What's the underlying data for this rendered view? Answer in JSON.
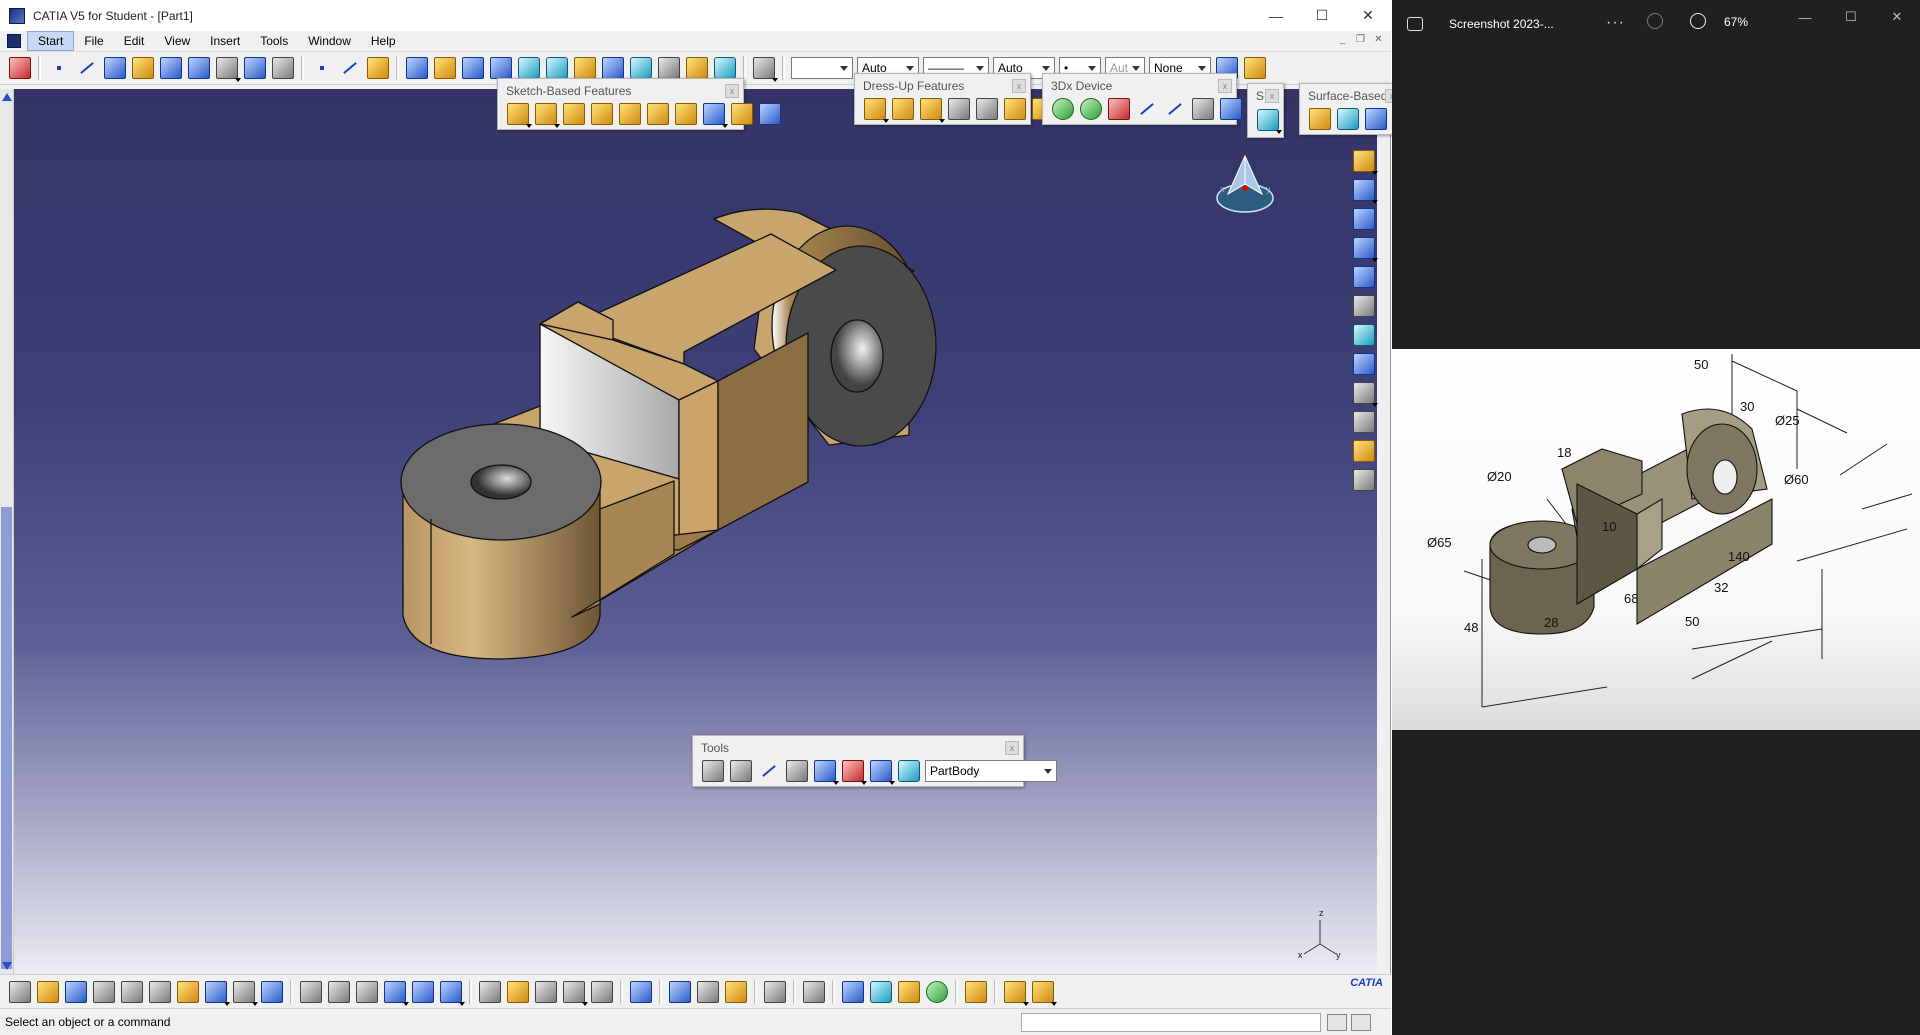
{
  "window": {
    "title": "CATIA V5 for Student - [Part1]"
  },
  "menu": [
    "Start",
    "File",
    "Edit",
    "View",
    "Insert",
    "Tools",
    "Window",
    "Help"
  ],
  "toolbar": {
    "combo_color": "",
    "combo_transparency": "Auto",
    "combo_linetype": "———",
    "combo_thickness": "Auto",
    "combo_point": "•",
    "combo_layer_disabled": "Aut",
    "combo_filter": "None"
  },
  "floating_toolbars": {
    "sketch_based": "Sketch-Based Features",
    "dress_up": "Dress-Up Features",
    "device": "3Dx Device",
    "small": "S...",
    "surface_based": "Surface-Based F...",
    "tools": "Tools",
    "tools_body": "PartBody"
  },
  "compass": {
    "x": "x",
    "y": "y"
  },
  "axis": {
    "x": "x",
    "y": "y",
    "z": "z"
  },
  "brand": "CATIA",
  "status": {
    "text": "Select an object or a command"
  },
  "photos": {
    "title": "Screenshot 2023-...",
    "more": "···",
    "zoom": "67%"
  },
  "drawing_dims": {
    "d50_top": "50",
    "d30": "30",
    "dia25": "Ø25",
    "dia60": "Ø60",
    "d18": "18",
    "dia20": "Ø20",
    "dia65": "Ø65",
    "d10": "10",
    "d140": "140",
    "d32": "32",
    "d68": "68",
    "d50_bottom": "50",
    "d28": "28",
    "d48": "48"
  },
  "colors": {
    "part_tan": "#c9a56e",
    "part_dark": "#6e5634",
    "background_top": "#343467",
    "menu_highlight": "#c6d8f3"
  }
}
